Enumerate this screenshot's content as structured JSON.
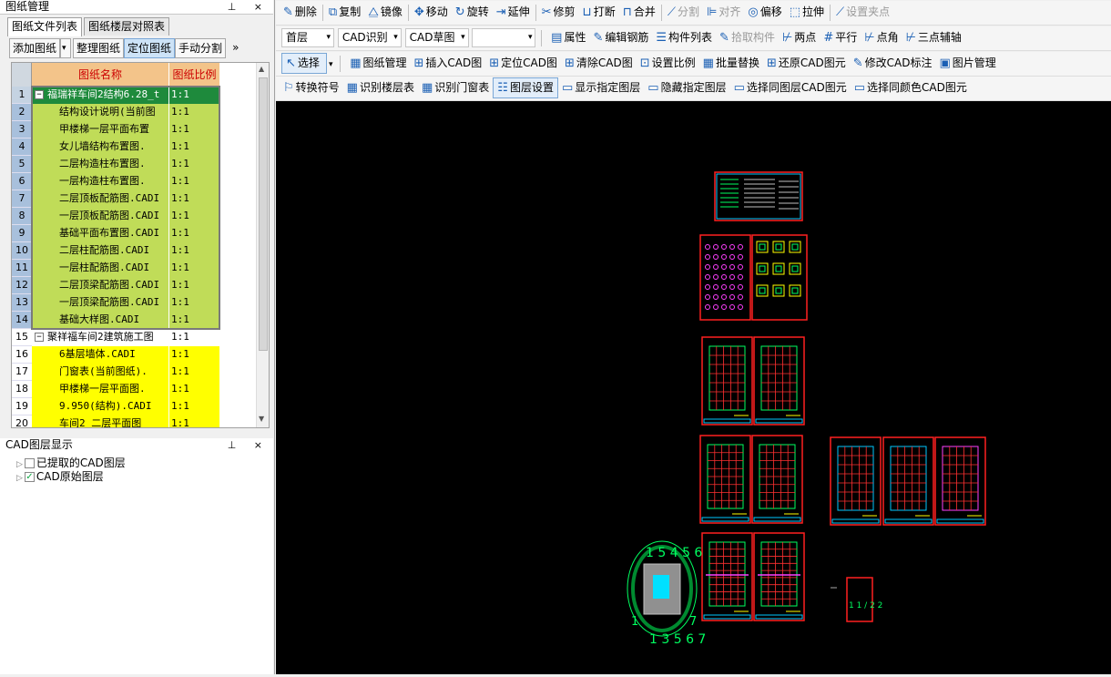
{
  "left_panel": {
    "title": "图纸管理",
    "title_btns": "⊥ ×",
    "tabs": [
      "图纸文件列表",
      "图纸楼层对照表"
    ],
    "buttons": [
      "添加图纸",
      "整理图纸",
      "定位图纸",
      "手动分割"
    ],
    "more": "»",
    "dropdown_arrow": "▾",
    "columns": [
      "图纸名称",
      "图纸比例"
    ],
    "rows": [
      {
        "n": "1",
        "name": "福瑞祥车间2结构6.28_t",
        "scale": "1:1"
      },
      {
        "n": "2",
        "name": "结构设计说明(当前图",
        "scale": "1:1"
      },
      {
        "n": "3",
        "name": "甲楼梯一层平面布置",
        "scale": "1:1"
      },
      {
        "n": "4",
        "name": "女儿墙结构布置图.",
        "scale": "1:1"
      },
      {
        "n": "5",
        "name": "二层构造柱布置图.",
        "scale": "1:1"
      },
      {
        "n": "6",
        "name": "一层构造柱布置图.",
        "scale": "1:1"
      },
      {
        "n": "7",
        "name": "二层顶板配筋图.CADI",
        "scale": "1:1"
      },
      {
        "n": "8",
        "name": "一层顶板配筋图.CADI",
        "scale": "1:1"
      },
      {
        "n": "9",
        "name": "基础平面布置图.CADI",
        "scale": "1:1"
      },
      {
        "n": "10",
        "name": "二层柱配筋图.CADI",
        "scale": "1:1"
      },
      {
        "n": "11",
        "name": "一层柱配筋图.CADI",
        "scale": "1:1"
      },
      {
        "n": "12",
        "name": "二层顶梁配筋图.CADI",
        "scale": "1:1"
      },
      {
        "n": "13",
        "name": "一层顶梁配筋图.CADI",
        "scale": "1:1"
      },
      {
        "n": "14",
        "name": "基础大样图.CADI",
        "scale": "1:1"
      },
      {
        "n": "15",
        "name": "聚祥福车间2建筑施工图",
        "scale": "1:1"
      },
      {
        "n": "16",
        "name": "6基层墙体.CADI",
        "scale": "1:1"
      },
      {
        "n": "17",
        "name": "门窗表(当前图纸).",
        "scale": "1:1"
      },
      {
        "n": "18",
        "name": "甲楼梯一层平面图.",
        "scale": "1:1"
      },
      {
        "n": "19",
        "name": "9.950(结构).CADI",
        "scale": "1:1"
      },
      {
        "n": "20",
        "name": "车间2 二层平面图",
        "scale": "1:1"
      }
    ],
    "layer_panel_title": "CAD图层显示",
    "layer_items": [
      "已提取的CAD图层",
      "CAD原始图层"
    ]
  },
  "toolbar1": [
    {
      "icon": "✎",
      "label": "删除"
    },
    {
      "icon": "⧉",
      "label": "复制"
    },
    {
      "icon": "⧋",
      "label": "镜像"
    },
    {
      "icon": "✥",
      "label": "移动"
    },
    {
      "icon": "↻",
      "label": "旋转"
    },
    {
      "icon": "⇥",
      "label": "延伸"
    },
    {
      "icon": "✂",
      "label": "修剪"
    },
    {
      "icon": "⊔",
      "label": "打断"
    },
    {
      "icon": "⊓",
      "label": "合并"
    },
    {
      "icon": "⟋",
      "label": "分割"
    },
    {
      "icon": "⊫",
      "label": "对齐"
    },
    {
      "icon": "◎",
      "label": "偏移"
    },
    {
      "icon": "⬚",
      "label": "拉伸"
    },
    {
      "icon": "⟋",
      "label": "设置夹点"
    }
  ],
  "toolbar2": {
    "floor": "首层",
    "recog": "CAD识别",
    "sketch": "CAD草图",
    "blank": "",
    "items": [
      {
        "icon": "▤",
        "label": "属性"
      },
      {
        "icon": "✎",
        "label": "编辑钢筋"
      },
      {
        "icon": "☰",
        "label": "构件列表"
      },
      {
        "icon": "✎",
        "label": "拾取构件"
      },
      {
        "icon": "⊬",
        "label": "两点"
      },
      {
        "icon": "#",
        "label": "平行"
      },
      {
        "icon": "⊬",
        "label": "点角"
      },
      {
        "icon": "⊬",
        "label": "三点辅轴"
      }
    ]
  },
  "toolbar3": {
    "select": "选择",
    "items": [
      {
        "icon": "▦",
        "label": "图纸管理"
      },
      {
        "icon": "⊞",
        "label": "插入CAD图"
      },
      {
        "icon": "⊞",
        "label": "定位CAD图"
      },
      {
        "icon": "⊞",
        "label": "清除CAD图"
      },
      {
        "icon": "⊡",
        "label": "设置比例"
      },
      {
        "icon": "▦",
        "label": "批量替换"
      },
      {
        "icon": "⊞",
        "label": "还原CAD图元"
      },
      {
        "icon": "✎",
        "label": "修改CAD标注"
      },
      {
        "icon": "▣",
        "label": "图片管理"
      }
    ]
  },
  "toolbar4": [
    {
      "icon": "⚐",
      "label": "转换符号"
    },
    {
      "icon": "▦",
      "label": "识别楼层表"
    },
    {
      "icon": "▦",
      "label": "识别门窗表"
    },
    {
      "icon": "☷",
      "label": "图层设置"
    },
    {
      "icon": "▭",
      "label": "显示指定图层"
    },
    {
      "icon": "▭",
      "label": "隐藏指定图层"
    },
    {
      "icon": "▭",
      "label": "选择同图层CAD图元"
    },
    {
      "icon": "▭",
      "label": "选择同颜色CAD图元"
    }
  ],
  "drawing_texts": {
    "s1": "1 5 4 5 6",
    "s2": "1 3 5 6 7",
    "s3": "1",
    "s4": "7",
    "s5": "1 1 / 2 2"
  }
}
